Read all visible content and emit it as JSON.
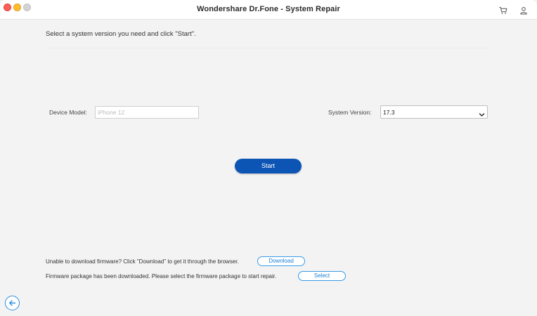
{
  "window": {
    "title": "Wondershare Dr.Fone - System Repair"
  },
  "titlebar_icons": {
    "cart": "cart-icon",
    "account": "user-icon"
  },
  "main": {
    "instruction": "Select a system version you need and click \"Start\".",
    "device_model": {
      "label": "Device Model:",
      "placeholder": "iPhone 12",
      "value": ""
    },
    "system_version": {
      "label": "System Version:",
      "selected": "17.3"
    },
    "start_label": "Start"
  },
  "footer": {
    "download_notice": "Unable to download firmware? Click \"Download\" to get it through the browser.",
    "download_label": "Download",
    "select_notice": "Firmware package has been downloaded. Please select the firmware package to start repair.",
    "select_label": "Select"
  },
  "colors": {
    "accent": "#0d55b5",
    "link_blue": "#1c7fd6",
    "close": "#fe5f57",
    "minimize": "#febc2e",
    "maximize_disabled": "#d3d3d3"
  }
}
